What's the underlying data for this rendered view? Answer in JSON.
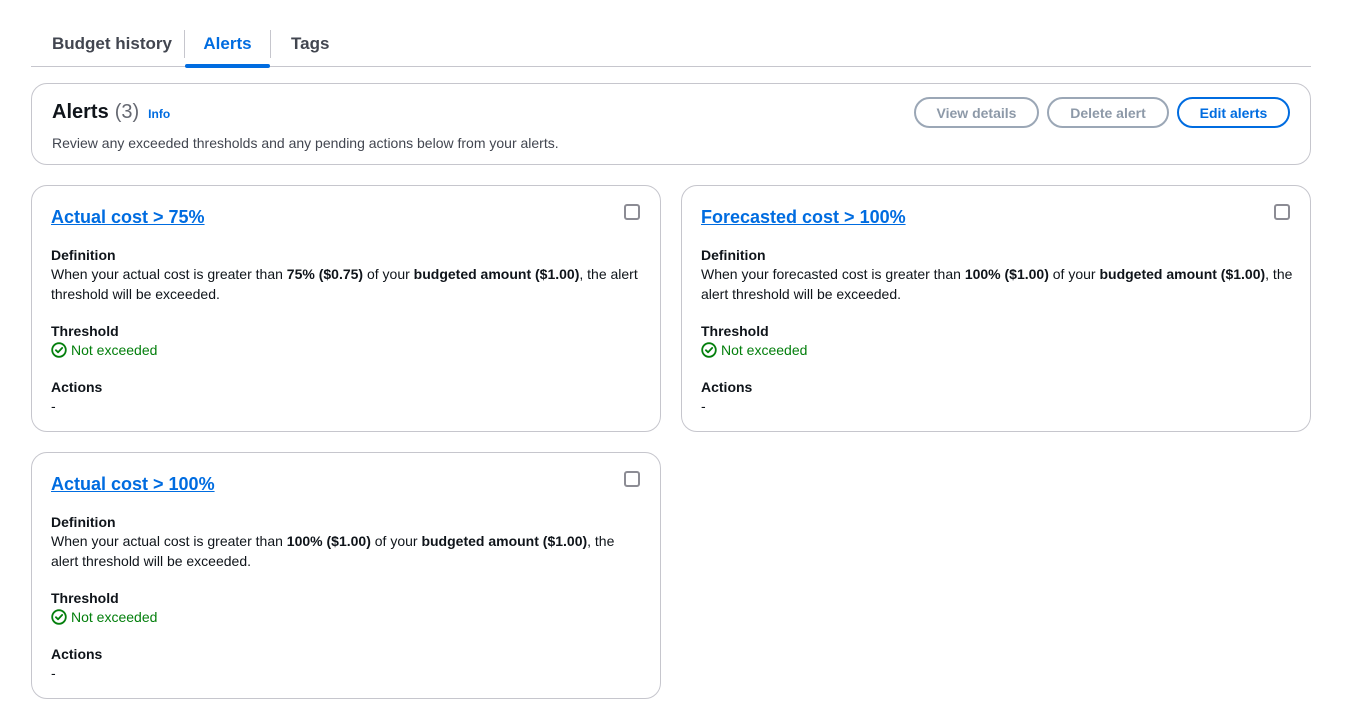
{
  "tabs": [
    {
      "label": "Budget history"
    },
    {
      "label": "Alerts"
    },
    {
      "label": "Tags"
    }
  ],
  "header": {
    "title": "Alerts",
    "count": "(3)",
    "info": "Info",
    "description": "Review any exceeded thresholds and any pending actions below from your alerts.",
    "buttons": {
      "view_details": "View details",
      "delete_alert": "Delete alert",
      "edit_alerts": "Edit alerts"
    }
  },
  "labels": {
    "definition": "Definition",
    "threshold": "Threshold",
    "actions": "Actions"
  },
  "colors": {
    "accent": "#006ce0",
    "success": "#037f0c",
    "border": "#c6c6cd"
  },
  "alerts": [
    {
      "title": "Actual cost > 75%",
      "def_prefix": "When your actual cost is greater than ",
      "def_pct": "75% ($0.75)",
      "def_mid": " of your ",
      "def_budget": "budgeted amount ($1.00)",
      "def_suffix": ", the alert threshold will be exceeded.",
      "threshold_status": "Not exceeded",
      "threshold_icon": "check-circle-icon",
      "actions": "-"
    },
    {
      "title": "Forecasted cost > 100%",
      "def_prefix": "When your forecasted cost is greater than ",
      "def_pct": "100% ($1.00)",
      "def_mid": " of your ",
      "def_budget": "budgeted amount ($1.00)",
      "def_suffix": ", the alert threshold will be exceeded.",
      "threshold_status": "Not exceeded",
      "threshold_icon": "check-circle-icon",
      "actions": "-"
    },
    {
      "title": "Actual cost > 100%",
      "def_prefix": "When your actual cost is greater than ",
      "def_pct": "100% ($1.00)",
      "def_mid": " of your ",
      "def_budget": "budgeted amount ($1.00)",
      "def_suffix": ", the alert threshold will be exceeded.",
      "threshold_status": "Not exceeded",
      "threshold_icon": "check-circle-icon",
      "actions": "-"
    }
  ]
}
